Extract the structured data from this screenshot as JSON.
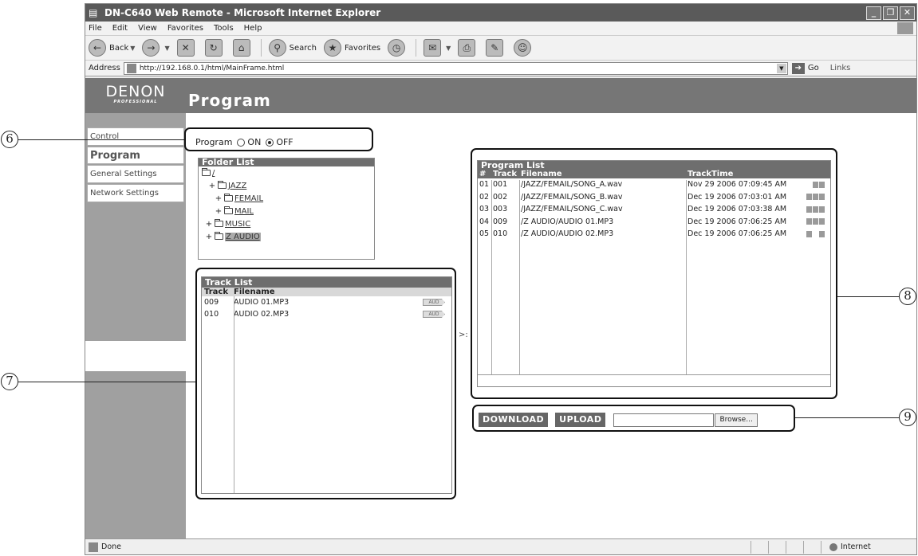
{
  "window": {
    "title": "DN-C640 Web Remote - Microsoft Internet Explorer",
    "menu": [
      "File",
      "Edit",
      "View",
      "Favorites",
      "Tools",
      "Help"
    ],
    "toolbar": {
      "back": "Back",
      "search": "Search",
      "favorites": "Favorites"
    },
    "address_label": "Address",
    "url": "http://192.168.0.1/html/MainFrame.html",
    "go_label": "Go",
    "links_label": "Links",
    "status_text": "Done",
    "zone_text": "Internet"
  },
  "page": {
    "logo": "DENON",
    "logo_sub": "PROFESSIONAL",
    "title": "Program"
  },
  "sidebar": {
    "items": [
      {
        "label": "Control",
        "active": false
      },
      {
        "label": "Program",
        "active": true
      },
      {
        "label": "General Settings",
        "active": false
      },
      {
        "label": "Network Settings",
        "active": false
      }
    ]
  },
  "program_toggle": {
    "label": "Program",
    "on_label": "ON",
    "off_label": "OFF",
    "selected": "OFF"
  },
  "folder_list": {
    "title": "Folder List",
    "root": "/",
    "folders": [
      {
        "name": "JAZZ",
        "level": 1
      },
      {
        "name": "FEMAIL",
        "level": 2
      },
      {
        "name": "MAIL",
        "level": 2
      },
      {
        "name": "MUSIC",
        "level": 1
      },
      {
        "name": "Z AUDIO",
        "level": 1,
        "selected": true
      }
    ]
  },
  "track_list": {
    "title": "Track List",
    "col_track": "Track",
    "col_filename": "Filename",
    "rows": [
      {
        "track": "009",
        "filename": "AUDIO 01.MP3",
        "tag": "AUD"
      },
      {
        "track": "010",
        "filename": "AUDIO 02.MP3",
        "tag": "AUD"
      }
    ]
  },
  "transfer_arrow": ">:",
  "program_list": {
    "title": "Program List",
    "col_num": "#",
    "col_track": "Track",
    "col_filename": "Filename",
    "col_time": "TrackTime",
    "rows": [
      {
        "num": "01",
        "track": "001",
        "filename": "/JAZZ/FEMAIL/SONG_A.wav",
        "time": "Nov 29 2006 07:09:45 AM",
        "up": false,
        "down": true
      },
      {
        "num": "02",
        "track": "002",
        "filename": "/JAZZ/FEMAIL/SONG_B.wav",
        "time": "Dec 19 2006 07:03:01 AM",
        "up": true,
        "down": true
      },
      {
        "num": "03",
        "track": "003",
        "filename": "/JAZZ/FEMAIL/SONG_C.wav",
        "time": "Dec 19 2006 07:03:38 AM",
        "up": true,
        "down": true
      },
      {
        "num": "04",
        "track": "009",
        "filename": "/Z AUDIO/AUDIO 01.MP3",
        "time": "Dec 19 2006 07:06:25 AM",
        "up": true,
        "down": true
      },
      {
        "num": "05",
        "track": "010",
        "filename": "/Z AUDIO/AUDIO 02.MP3",
        "time": "Dec 19 2006 07:06:25 AM",
        "up": true,
        "down": false
      }
    ]
  },
  "actions": {
    "download": "DOWNLOAD",
    "upload": "UPLOAD",
    "browse": "Browse..."
  },
  "callouts": [
    "6",
    "7",
    "8",
    "9"
  ]
}
